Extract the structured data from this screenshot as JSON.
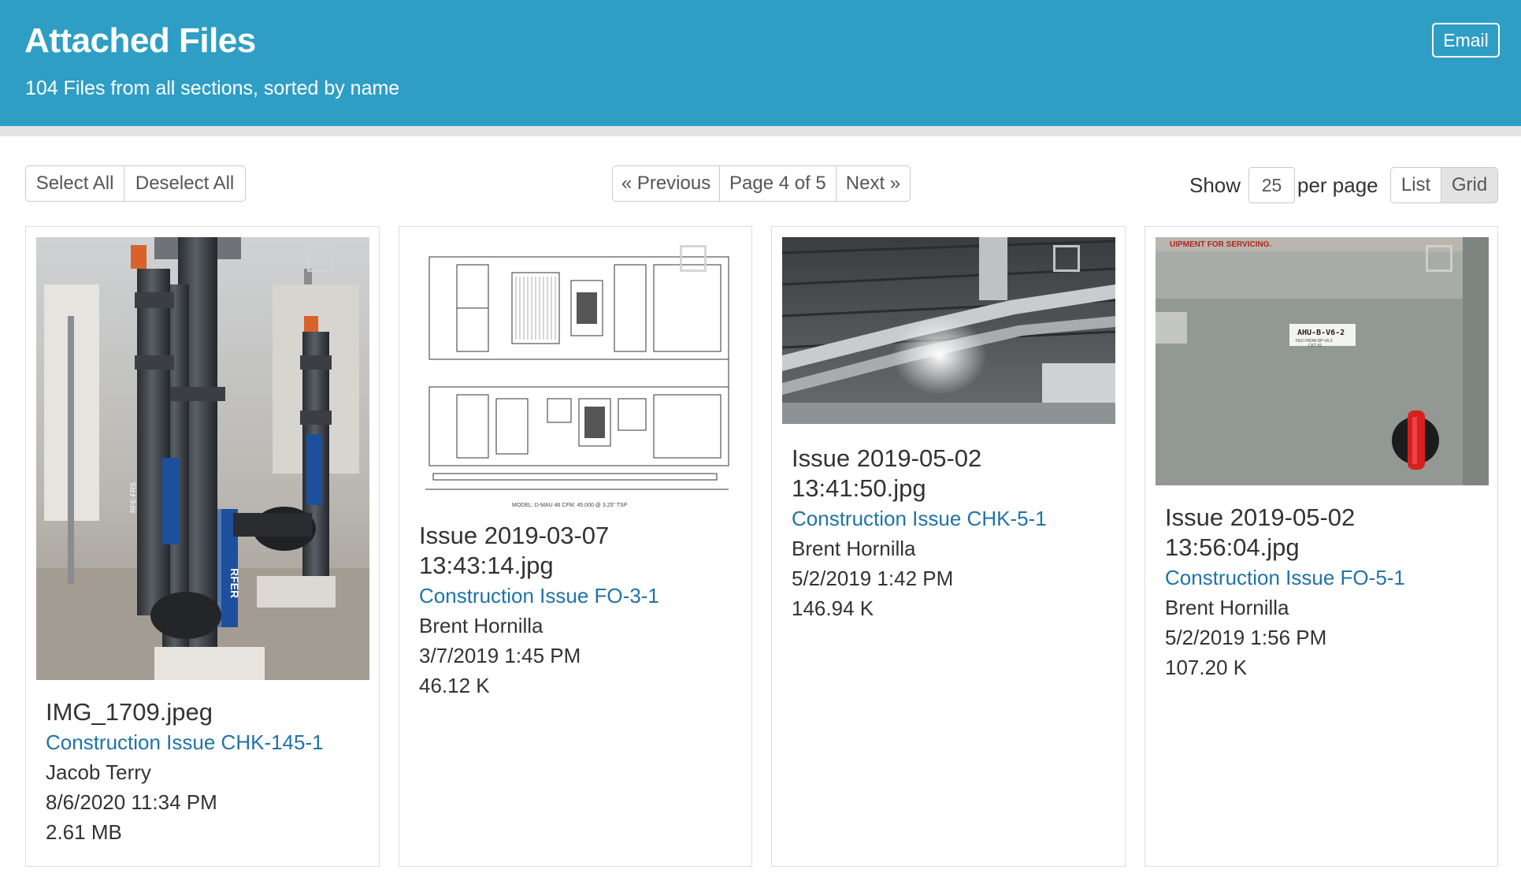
{
  "header": {
    "title": "Attached Files",
    "subtitle": "104 Files from all sections, sorted by name",
    "email_label": "Email"
  },
  "toolbar": {
    "select_all": "Select All",
    "deselect_all": "Deselect All",
    "previous": "« Previous",
    "page_status": "Page 4 of 5",
    "next": "Next »",
    "show_label": "Show",
    "per_page_value": "25",
    "per_page_label": "per page",
    "list_label": "List",
    "grid_label": "Grid",
    "active_view": "Grid"
  },
  "files": [
    {
      "name": "IMG_1709.jpeg",
      "issue": "Construction Issue CHK-145-1",
      "author": "Jacob Terry",
      "date": "8/6/2020 11:34 PM",
      "size": "2.61 MB",
      "thumbnail": "photo-mechanical-room-pipes"
    },
    {
      "name": "Issue 2019-03-07 13:43:14.jpg",
      "issue": "Construction Issue FO-3-1",
      "author": "Brent Hornilla",
      "date": "3/7/2019 1:45 PM",
      "size": "46.12 K",
      "thumbnail": "drawing-air-handling-unit"
    },
    {
      "name": "Issue 2019-05-02 13:41:50.jpg",
      "issue": "Construction Issue CHK-5-1",
      "author": "Brent Hornilla",
      "date": "5/2/2019 1:42 PM",
      "size": "146.94 K",
      "thumbnail": "photo-ceiling-ducts"
    },
    {
      "name": "Issue 2019-05-02 13:56:04.jpg",
      "issue": "Construction Issue FO-5-1",
      "author": "Brent Hornilla",
      "date": "5/2/2019 1:56 PM",
      "size": "107.20 K",
      "thumbnail": "photo-equipment-panel",
      "thumb_text": {
        "top": "UIPMENT FOR SERVICING.",
        "tag": "AHU-B-V6-2",
        "tag_sub1": "FED FROM DP-V6-2",
        "tag_sub2": "CKT #2"
      }
    }
  ],
  "thumb_labels": {
    "pipe_label": "RFER",
    "pipe_label_small": "RFE-FRS",
    "drawing_model": "MODEL: D-MAU 46     CFM: 45,000 @ 3.25\" TSP"
  },
  "colors": {
    "header_bg": "#2f9ec5",
    "link": "#1f73a6",
    "text": "#333333"
  }
}
